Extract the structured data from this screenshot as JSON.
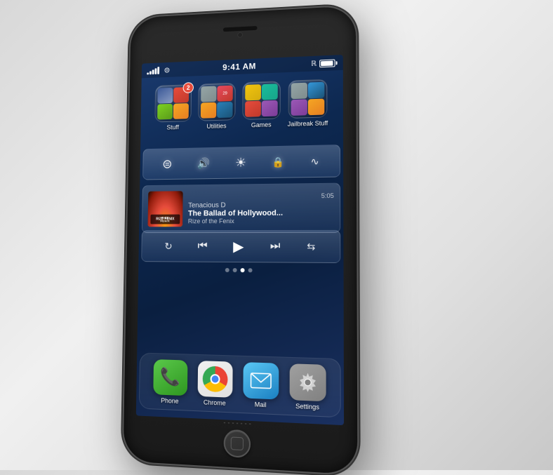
{
  "statusBar": {
    "time": "9:41 AM",
    "signal": [
      3,
      5,
      7,
      9,
      11
    ],
    "battery_percent": 85
  },
  "folders": [
    {
      "label": "Stuff",
      "badge": "2",
      "colors": [
        "blue",
        "red",
        "green",
        "orange"
      ]
    },
    {
      "label": "Utilities",
      "badge": null,
      "colors": [
        "gray",
        "orange",
        "purple",
        "blue"
      ]
    },
    {
      "label": "Games",
      "badge": null,
      "colors": [
        "yellow",
        "teal",
        "red",
        "blue-dark"
      ]
    },
    {
      "label": "Jailbreak Stuff",
      "badge": null,
      "colors": [
        "gray",
        "blue",
        "purple",
        "orange"
      ]
    }
  ],
  "controls": {
    "icons": [
      "wifi",
      "volume",
      "brightness",
      "lock",
      "signal"
    ]
  },
  "nowPlaying": {
    "time": "5:05",
    "artist": "Tenacious D",
    "title": "The Ballad of Hollywood...",
    "album": "Rize of the Fenix"
  },
  "playback": {
    "icons": [
      "repeat",
      "prev",
      "play",
      "next",
      "shuffle"
    ]
  },
  "dock": {
    "apps": [
      {
        "label": "Phone",
        "type": "phone"
      },
      {
        "label": "Chrome",
        "type": "chrome"
      },
      {
        "label": "Mail",
        "type": "mail"
      },
      {
        "label": "Settings",
        "type": "settings"
      }
    ]
  },
  "pageDots": {
    "count": 4,
    "active": 2
  }
}
